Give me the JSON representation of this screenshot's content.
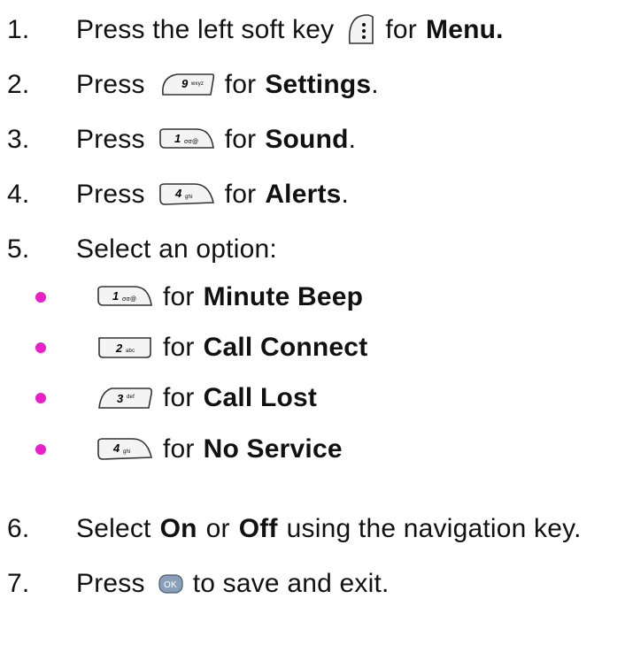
{
  "steps": [
    {
      "num": "1.",
      "pre": "Press the left soft key",
      "mid": "for",
      "bold": "Menu.",
      "post": "",
      "key": "left-softkey-icon"
    },
    {
      "num": "2.",
      "pre": "Press",
      "mid": "for",
      "bold": "Settings",
      "post": ".",
      "key": "key-9-wxyz-icon",
      "key_label": "9",
      "key_sub": "wxyz"
    },
    {
      "num": "3.",
      "pre": "Press",
      "mid": "for",
      "bold": "Sound",
      "post": ".",
      "key": "key-1-icon",
      "key_label": "1",
      "key_sub": "σσ@"
    },
    {
      "num": "4.",
      "pre": "Press",
      "mid": "for",
      "bold": "Alerts",
      "post": ".",
      "key": "key-4-ghi-icon",
      "key_label": "4",
      "key_sub": "ghi"
    },
    {
      "num": "5.",
      "text": "Select an option:"
    },
    {
      "num": "6.",
      "pre": "Select",
      "bold1": "On",
      "mid": "or",
      "bold2": "Off",
      "post": "using the navigation key."
    },
    {
      "num": "7.",
      "pre": "Press",
      "post": "to save and exit.",
      "key": "ok-key-icon",
      "key_label": "OK"
    }
  ],
  "options": [
    {
      "mid": "for",
      "bold": "Minute Beep",
      "key": "key-1-icon",
      "key_label": "1",
      "key_sub": "σσ@"
    },
    {
      "mid": "for",
      "bold": "Call Connect",
      "key": "key-2-abc-icon",
      "key_label": "2",
      "key_sub": "abc"
    },
    {
      "mid": "for",
      "bold": "Call Lost",
      "key": "key-3-def-icon",
      "key_label": "3",
      "key_sub": "def"
    },
    {
      "mid": "for",
      "bold": "No Service",
      "key": "key-4-ghi-icon",
      "key_label": "4",
      "key_sub": "ghi"
    }
  ],
  "colors": {
    "bullet": "#ec1ec8",
    "ok_key": "#8aa0b8"
  }
}
